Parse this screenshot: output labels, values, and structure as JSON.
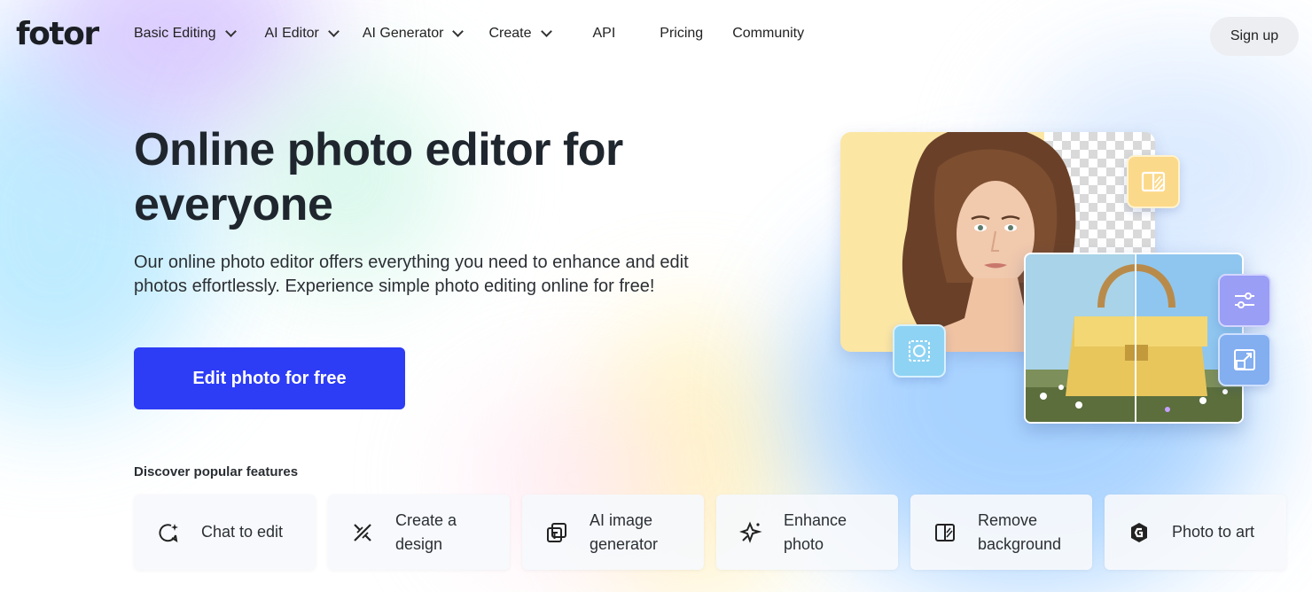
{
  "brand": {
    "logo": "fotor",
    "accent": "#2d3cf5"
  },
  "nav": {
    "items": [
      {
        "label": "Basic Editing",
        "dropdown": true
      },
      {
        "label": "AI Editor",
        "dropdown": true
      },
      {
        "label": "AI Generator",
        "dropdown": true
      },
      {
        "label": "Create",
        "dropdown": true
      },
      {
        "label": "API",
        "dropdown": false
      },
      {
        "label": "Pricing",
        "dropdown": false
      },
      {
        "label": "Community",
        "dropdown": false
      }
    ],
    "signup_label": "Sign up"
  },
  "hero": {
    "title": "Online photo editor for everyone",
    "description": "Our online photo editor offers everything you need to enhance and edit photos effortlessly. Experience simple photo editing online for free!",
    "cta_label": "Edit photo for free"
  },
  "features": {
    "heading": "Discover popular features",
    "items": [
      {
        "label": "Chat to edit",
        "icon": "chat-sparkle-icon"
      },
      {
        "label": "Create a design",
        "icon": "design-tools-icon"
      },
      {
        "label": "AI image generator",
        "icon": "ai-image-icon"
      },
      {
        "label": "Enhance photo",
        "icon": "enhance-sparkle-icon"
      },
      {
        "label": "Remove background",
        "icon": "remove-bg-icon"
      },
      {
        "label": "Photo to art",
        "icon": "photo-to-art-icon"
      }
    ]
  },
  "illustration": {
    "tools": [
      "remove-bg-tool-icon",
      "portrait-retouch-icon",
      "adjust-sliders-icon",
      "resize-icon"
    ]
  }
}
